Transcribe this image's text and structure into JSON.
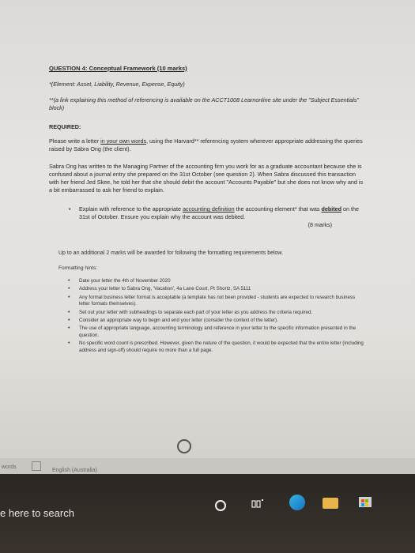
{
  "document": {
    "question_title": "QUESTION 4: Conceptual Framework (10 marks)",
    "element_line": "*(Element: Asset, Liability, Revenue, Expense, Equity)",
    "link_line": "**(a link explaining this method of referencing is available on the ACCT1008 Learnonline site under the \"Subject Essentials\" block)",
    "required_heading": "REQUIRED:",
    "req_pre": "Please write a letter ",
    "req_underlined": "in your own words",
    "req_post": ", using the Harvard** referencing system wherever appropriate addressing the queries raised by Sabra Ong (the client).",
    "scenario": "Sabra Ong has written to the Managing Partner of the accounting firm you work for as a graduate accountant because she is confused about a journal entry she prepared on the 31st October (see question 2). When Sabra discussed this transaction with her friend Jed Skee, he told her that she should debit the account \"Accounts Payable\" but she does not know why and is a bit embarrassed to ask her friend to explain.",
    "bullet_pre": "Explain with reference to the appropriate ",
    "bullet_underlined": "accounting definition",
    "bullet_mid": " the accounting element* that was ",
    "bullet_debited": "debited",
    "bullet_post": " on the 31st of October. Ensure you explain why the account was debited.",
    "bullet_marks": "(8 marks)",
    "formatting_intro": "Up to an additional 2 marks will be awarded for following the formatting requirements below.",
    "formatting_hints_label": "Formatting hints:",
    "hints": [
      "Date your letter the 4th of November 2020",
      "Address your letter to Sabra Ong, 'Vacation', 4a Lane Court, Pt Shortz, SA 5111",
      "Any formal business letter format is acceptable (a template has not been provided - students are expected to research business letter formats themselves).",
      "Set out your letter with subheadings to separate each part of your letter as you address the criteria required.",
      "Consider an appropriate way to begin and end your letter (consider the context of the letter).",
      "The use of appropriate language, accounting terminology and reference in your letter to the specific information presented in the question.",
      "No specific word count is prescribed. However, given the nature of the question, it would be expected that the entire letter (including address and sign-off) should require no more than a full page."
    ]
  },
  "statusbar": {
    "words_label": "words",
    "language": "English (Australia)"
  },
  "taskbar": {
    "search_placeholder": "e here to search"
  },
  "icons": {
    "cortana": "cortana-icon",
    "task_view": "task-view-icon",
    "edge": "edge-icon",
    "explorer": "file-explorer-icon",
    "store": "store-icon"
  }
}
